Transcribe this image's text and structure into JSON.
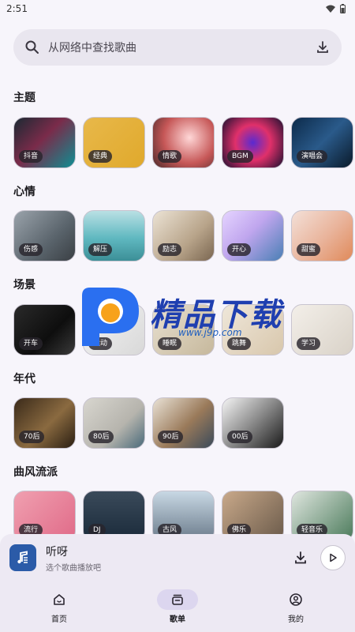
{
  "status_bar": {
    "time": "2:51"
  },
  "search": {
    "placeholder": "从网络中查找歌曲"
  },
  "sections": [
    {
      "title": "主题",
      "tiles": [
        {
          "label": "抖音",
          "bg": "linear-gradient(135deg,#1b2a33,#7a2b4a 45%,#0e8f93)"
        },
        {
          "label": "经典",
          "bg": "linear-gradient(135deg,#e8b84a,#e0a92c)"
        },
        {
          "label": "情歌",
          "bg": "radial-gradient(circle at 60% 40%,#ffd7d7,#c65757 55%,#4a2a2a)"
        },
        {
          "label": "BGM",
          "bg": "radial-gradient(circle at 50% 50%,#5a2ad0,#e0306a 45%,#1a1030)"
        },
        {
          "label": "演唱会",
          "bg": "linear-gradient(135deg,#0c2a4a,#2a5a8a 50%,#0a1a2a)"
        }
      ]
    },
    {
      "title": "心情",
      "tiles": [
        {
          "label": "伤感",
          "bg": "linear-gradient(135deg,#9aa3ab,#5a646c 60%,#3a3f44)"
        },
        {
          "label": "解压",
          "bg": "linear-gradient(180deg,#b9e0e4,#5fb8c0 55%,#3c8f97)"
        },
        {
          "label": "励志",
          "bg": "linear-gradient(135deg,#ece3d5,#b8a48a 60%,#7a6650)"
        },
        {
          "label": "开心",
          "bg": "linear-gradient(135deg,#e5d4ff,#c0a6ee 45%,#4a7fb5)"
        },
        {
          "label": "甜蜜",
          "bg": "linear-gradient(135deg,#f3e0d8,#e9b39a 55%,#e08a5a)"
        }
      ]
    },
    {
      "title": "场景",
      "tiles": [
        {
          "label": "开车",
          "bg": "linear-gradient(135deg,#2a2a2a,#0e0e0e 60%,#3a3a3a)"
        },
        {
          "label": "运动",
          "bg": "linear-gradient(135deg,#f5f5f5,#d8d8d8)"
        },
        {
          "label": "睡眠",
          "bg": "linear-gradient(135deg,#e8e0d0,#c6b89c)"
        },
        {
          "label": "跳舞",
          "bg": "linear-gradient(135deg,#efe7da,#d8c7ac)"
        },
        {
          "label": "学习",
          "bg": "linear-gradient(135deg,#f3efe9,#d9d2c8)"
        }
      ]
    },
    {
      "title": "年代",
      "tiles": [
        {
          "label": "70后",
          "bg": "linear-gradient(135deg,#3a2a1a,#8a6a40 55%,#2a1e12)"
        },
        {
          "label": "80后",
          "bg": "linear-gradient(135deg,#d8d6cf,#b6b4ad 60%,#4a6a7a)"
        },
        {
          "label": "90后",
          "bg": "linear-gradient(135deg,#e9e2d6,#9a7a5a 55%,#3a4a5a)"
        },
        {
          "label": "00后",
          "bg": "linear-gradient(135deg,#f5f5f5,#8a8a8a 50%,#1a1a1a)"
        }
      ]
    },
    {
      "title": "曲风流派",
      "tiles": [
        {
          "label": "流行",
          "bg": "linear-gradient(135deg,#f0a0b0,#e06a88)"
        },
        {
          "label": "DJ",
          "bg": "linear-gradient(180deg,#3a4a5a,#1a2a3a)"
        },
        {
          "label": "古风",
          "bg": "linear-gradient(180deg,#c8d8e4,#6a7a8a)"
        },
        {
          "label": "佛乐",
          "bg": "linear-gradient(135deg,#c9a98a,#6a5a4a)"
        },
        {
          "label": "轻音乐",
          "bg": "linear-gradient(135deg,#dfe6df,#4a7a5a)"
        }
      ]
    }
  ],
  "watermark": {
    "text": "精品下载",
    "url": "www.j9p.com"
  },
  "player": {
    "title": "听呀",
    "subtitle": "选个歌曲播放吧"
  },
  "nav": [
    {
      "label": "首页",
      "icon": "home-icon"
    },
    {
      "label": "歌单",
      "icon": "playlist-icon",
      "active": true
    },
    {
      "label": "我的",
      "icon": "profile-icon"
    }
  ]
}
